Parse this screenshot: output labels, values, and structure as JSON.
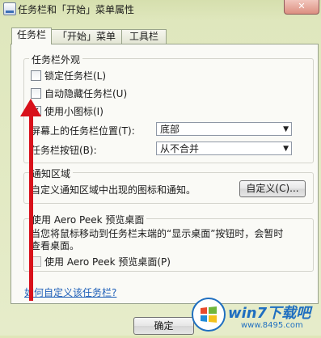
{
  "window": {
    "title": "任务栏和「开始」菜单属性",
    "close_glyph": "✕"
  },
  "tabs": [
    {
      "label": "任务栏"
    },
    {
      "label": "「开始」菜单"
    },
    {
      "label": "工具栏"
    }
  ],
  "appearance": {
    "group_title": "任务栏外观",
    "lock_label": "锁定任务栏(L)",
    "lock_checked": false,
    "autohide_label": "自动隐藏任务栏(U)",
    "autohide_checked": false,
    "small_icons_label": "使用小图标(I)",
    "small_icons_checked": true,
    "check_glyph": "✔",
    "position_label": "屏幕上的任务栏位置(T):",
    "position_value": "底部",
    "buttons_label": "任务栏按钮(B):",
    "buttons_value": "从不合并",
    "combo_arrow": "▼"
  },
  "notification": {
    "group_title": "通知区域",
    "description": "自定义通知区域中出现的图标和通知。",
    "customize_button": "自定义(C)..."
  },
  "aero_peek": {
    "group_title": "使用 Aero Peek 预览桌面",
    "description_line1": "当您将鼠标移动到任务栏末端的“显示桌面”按钮时，会暂时",
    "description_line2": "查看桌面。",
    "checkbox_label": "使用 Aero Peek 预览桌面(P)",
    "checked": false
  },
  "help_link": "如何自定义该任务栏?",
  "footer": {
    "ok_label": "确定"
  },
  "watermark": {
    "brand": "win7下载吧",
    "url": "www.8495.com"
  },
  "colors": {
    "annotation_arrow": "#d8111a",
    "link": "#1e5fb8",
    "watermark_blue": "#1f6fc0"
  }
}
